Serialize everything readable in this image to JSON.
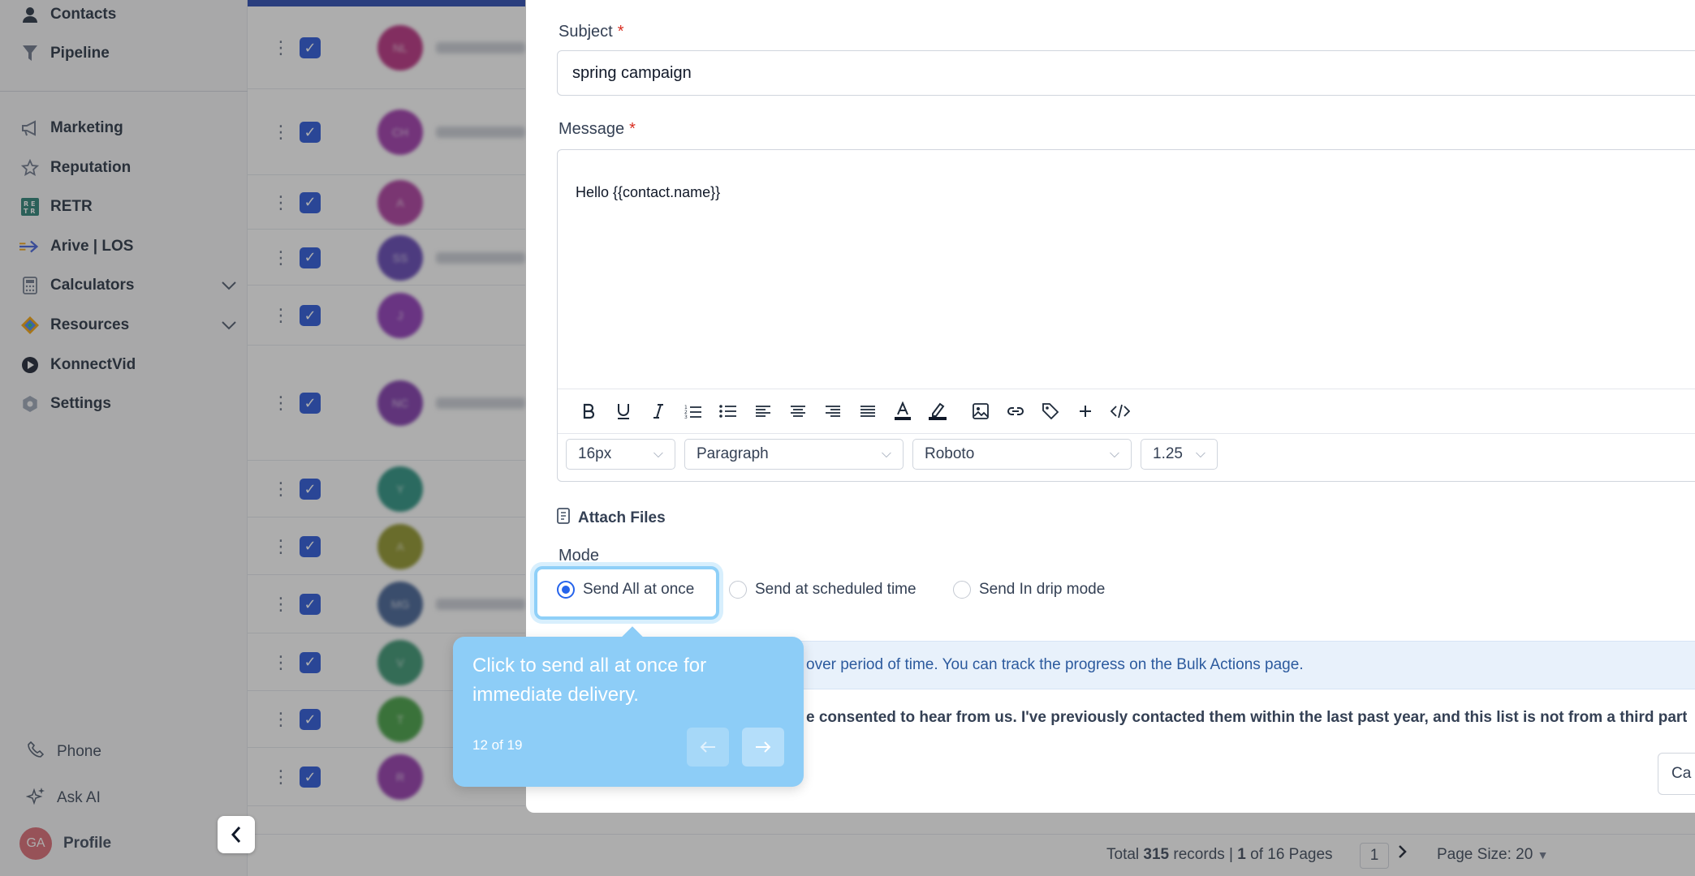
{
  "sidebar": {
    "items": [
      {
        "label": "Contacts",
        "icon": "person-icon"
      },
      {
        "label": "Pipeline",
        "icon": "funnel-icon"
      },
      {
        "label": "Marketing",
        "icon": "megaphone-icon"
      },
      {
        "label": "Reputation",
        "icon": "star-icon"
      },
      {
        "label": "RETR",
        "icon": "retr-logo-icon"
      },
      {
        "label": "Arive | LOS",
        "icon": "arive-arrow-icon"
      },
      {
        "label": "Calculators",
        "icon": "calculator-icon"
      },
      {
        "label": "Resources",
        "icon": "resources-icon"
      },
      {
        "label": "KonnectVid",
        "icon": "play-icon"
      },
      {
        "label": "Settings",
        "icon": "gear-icon"
      }
    ],
    "phone_label": "Phone",
    "ask_ai_label": "Ask AI",
    "profile_label": "Profile",
    "profile_initials": "GA"
  },
  "list": {
    "avatar_colors": [
      "#b5257a",
      "#9b2fa8",
      "#a8329a",
      "#5b3bb0",
      "#8a2fb5",
      "#7a2fa8",
      "#1f8c7a",
      "#8a8f1f",
      "#3a5a8f",
      "#2f8f6a",
      "#3a9a3a",
      "#8f2fa8"
    ],
    "avatar_initials": [
      "NL",
      "CH",
      "A",
      "SS",
      "J",
      "NC",
      "Y",
      "A",
      "MG",
      "V",
      "T",
      "R"
    ]
  },
  "footer": {
    "total_prefix": "Total ",
    "total_count": "315",
    "total_mid": " records | ",
    "current_page": "1",
    "of_pages": " of 16 Pages",
    "page_box": "1",
    "page_size": "Page Size: 20"
  },
  "drawer": {
    "subject_label": "Subject",
    "subject_value": "spring campaign",
    "message_label": "Message",
    "message_body": "Hello {{contact.name}}",
    "required_mark": "*",
    "font_size": "16px",
    "block_style": "Paragraph",
    "font_family": "Roboto",
    "line_height": "1.25",
    "attach_label": "Attach Files",
    "mode_label": "Mode",
    "mode_options": [
      "Send All at once",
      "Send at scheduled time",
      "Send In drip mode"
    ],
    "info_text": "over period of time. You can track the progress on the Bulk Actions page.",
    "consent_text": "e consented to hear from us. I've previously contacted them within the last past year, and this list is not from a third party",
    "cancel_label": "Ca"
  },
  "tour": {
    "message": "Click to send all at once for immediate delivery.",
    "step": "12 of 19"
  },
  "colors": {
    "accent_blue": "#2563eb",
    "checkbox_blue": "#1e4fd8",
    "tooltip_blue": "#8dcdf7",
    "info_bg": "#e8f1fb",
    "required_red": "#d92d20"
  }
}
